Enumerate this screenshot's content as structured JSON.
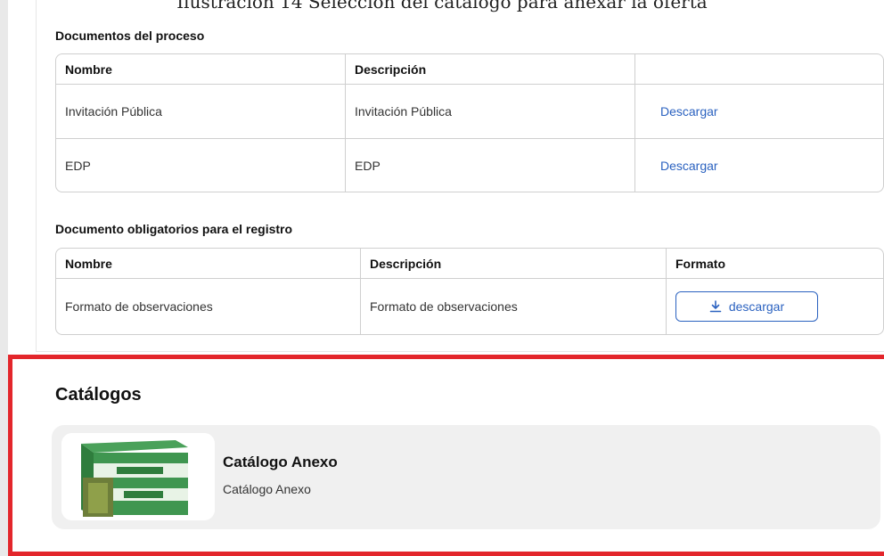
{
  "caption": "Ilustración 14 Selección del catálogo para anexar la oferta",
  "process_docs": {
    "title": "Documentos del proceso",
    "headers": [
      "Nombre",
      "Descripción",
      ""
    ],
    "rows": [
      {
        "name": "Invitación Pública",
        "description": "Invitación Pública",
        "action": "Descargar"
      },
      {
        "name": "EDP",
        "description": "EDP",
        "action": "Descargar"
      }
    ]
  },
  "required_docs": {
    "title": "Documento obligatorios para el registro",
    "headers": [
      "Nombre",
      "Descripción",
      "Formato"
    ],
    "rows": [
      {
        "name": "Formato de observaciones",
        "description": "Formato de observaciones",
        "action": "descargar",
        "icon": "download-icon"
      }
    ]
  },
  "catalogs": {
    "title": "Catálogos",
    "items": [
      {
        "name": "Catálogo Anexo",
        "description": "Catálogo Anexo",
        "thumbnail": "product-box-image"
      }
    ]
  },
  "colors": {
    "accent": "#2b62c0",
    "highlight": "#e3262b",
    "card": "#f0f0f0"
  }
}
